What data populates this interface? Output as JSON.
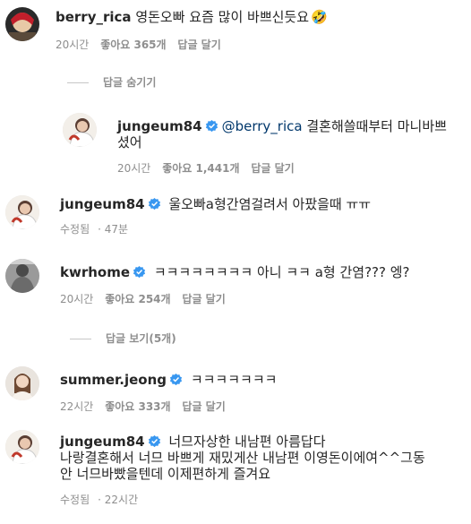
{
  "comments": [
    {
      "username": "berry_rica",
      "text": "영돈오빠 요즘 많이 바쁘신듯요",
      "emoji": "🤣",
      "time": "20시간",
      "likes": "좋아요 365개",
      "reply": "답글 달기"
    },
    {
      "username": "jungeum84",
      "mention": "@berry_rica",
      "text_a": "결혼해쓸때부터 마니바쁘",
      "text_b": "셨어",
      "time": "20시간",
      "likes": "좋아요 1,441개",
      "reply": "답글 달기"
    },
    {
      "username": "jungeum84",
      "text": "울오빠a형간염걸려서 아팠을때 ㅠㅠ",
      "edited": "수정됨",
      "time": "· 47분"
    },
    {
      "username": "kwrhome",
      "text": "ㅋㅋㅋㅋㅋㅋㅋㅋ 아니 ㅋㅋ a형 간염??? 엥?",
      "time": "20시간",
      "likes": "좋아요 254개",
      "reply": "답글 달기"
    },
    {
      "username": "summer.jeong",
      "text": "ㅋㅋㅋㅋㅋㅋㅋ",
      "time": "22시간",
      "likes": "좋아요 333개",
      "reply": "답글 달기"
    },
    {
      "username": "jungeum84",
      "text_1": "너므자상한 내남편 아름답다",
      "text_2": "나랑결혼해서 너므 바쁘게 재밌게산 내남편 이영돈이에여^^그동",
      "text_3": "안 너므바빴을텐데 이제편하게 즐겨요",
      "edited": "수정됨",
      "time": "· 22시간"
    }
  ],
  "toggles": {
    "hide_replies": "답글 숨기기",
    "view_replies": "답글 보기(5개)"
  },
  "colors": {
    "verified": "#3897f0",
    "secondary_text": "#8e8e8e",
    "mention": "#00376b"
  }
}
